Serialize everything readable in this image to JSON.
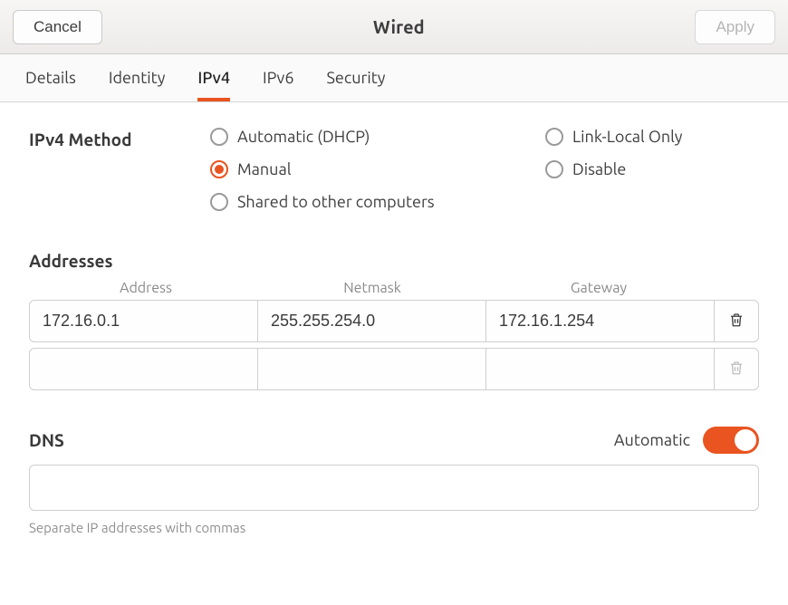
{
  "header": {
    "cancel_label": "Cancel",
    "title": "Wired",
    "apply_label": "Apply"
  },
  "tabs": [
    {
      "label": "Details",
      "active": false
    },
    {
      "label": "Identity",
      "active": false
    },
    {
      "label": "IPv4",
      "active": true
    },
    {
      "label": "IPv6",
      "active": false
    },
    {
      "label": "Security",
      "active": false
    }
  ],
  "ipv4": {
    "method_label": "IPv4 Method",
    "methods": {
      "automatic": "Automatic (DHCP)",
      "link_local": "Link-Local Only",
      "manual": "Manual",
      "disable": "Disable",
      "shared": "Shared to other computers"
    },
    "selected_method": "manual"
  },
  "addresses": {
    "title": "Addresses",
    "columns": {
      "address": "Address",
      "netmask": "Netmask",
      "gateway": "Gateway"
    },
    "rows": [
      {
        "address": "172.16.0.1",
        "netmask": "255.255.254.0",
        "gateway": "172.16.1.254"
      },
      {
        "address": "",
        "netmask": "",
        "gateway": ""
      }
    ]
  },
  "dns": {
    "title": "DNS",
    "automatic_label": "Automatic",
    "automatic_on": true,
    "value": "",
    "hint": "Separate IP addresses with commas"
  }
}
